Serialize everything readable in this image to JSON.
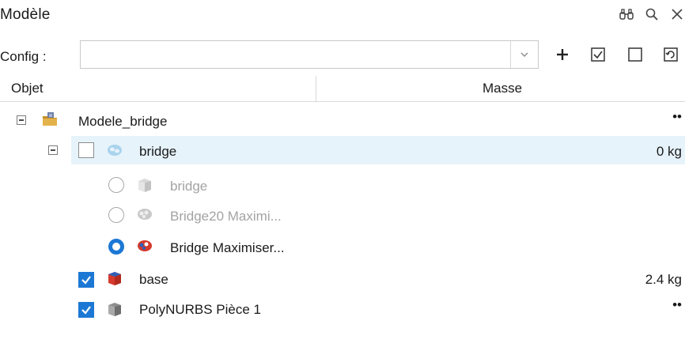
{
  "panel": {
    "title": "Modèle"
  },
  "config": {
    "label": "Config :",
    "value": ""
  },
  "columns": {
    "object": "Objet",
    "mass": "Masse"
  },
  "tree": {
    "root": {
      "label": "Modele_bridge",
      "mass": "••"
    },
    "bridge": {
      "label": "bridge",
      "mass": "0 kg"
    },
    "variants": [
      {
        "label": "bridge",
        "selected": false
      },
      {
        "label": "Bridge20 Maximi...",
        "selected": false
      },
      {
        "label": "Bridge Maximiser...",
        "selected": true
      }
    ],
    "base": {
      "label": "base",
      "mass": "2.4 kg"
    },
    "poly": {
      "label": "PolyNURBS Pièce 1",
      "mass": "••"
    }
  },
  "colors": {
    "accent": "#1c78d4",
    "selection": "#e6f3fb",
    "disabled_text": "#a3a3a3"
  }
}
